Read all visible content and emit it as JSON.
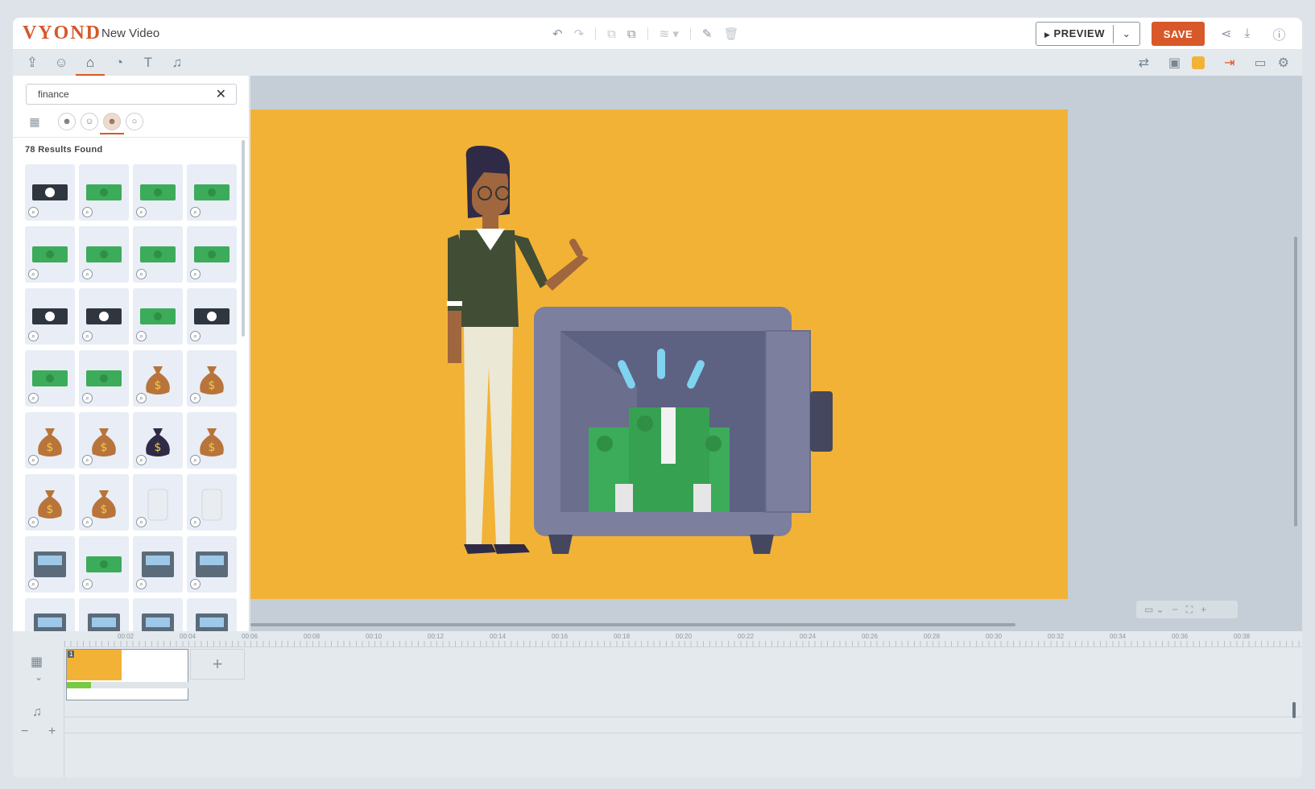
{
  "header": {
    "logo": "VYOND",
    "title": "New Video",
    "preview_label": "PREVIEW",
    "save_label": "SAVE"
  },
  "panel": {
    "search_value": "finance",
    "results_text": "78 Results Found"
  },
  "timeline": {
    "ticks": [
      "00:02",
      "00:04",
      "00:06",
      "00:08",
      "00:10",
      "00:12",
      "00:14",
      "00:16",
      "00:18",
      "00:20",
      "00:22",
      "00:24",
      "00:26",
      "00:28",
      "00:30",
      "00:32",
      "00:34",
      "00:36",
      "00:38"
    ],
    "scene_number": "1"
  },
  "colors": {
    "accent": "#d9582a",
    "canvas_bg": "#f2b236",
    "money_green": "#3cab5a"
  },
  "assets": [
    "bill-outline-icon",
    "bills-fan-icon",
    "money-stacks-icon",
    "bill-green-icon",
    "bill-band-icon",
    "bill-stack-icon",
    "bill-single-icon",
    "bills-fan-icon",
    "bill-dark-icon",
    "bill-dark-stack-icon",
    "bill-flying-icon",
    "bill-dark-pile-icon",
    "bill-wings-icon",
    "bills-flying-icon",
    "money-bag-dollar-icon",
    "money-bag-full-icon",
    "money-bag-icon",
    "money-sack-full-icon",
    "money-bag-dark-dollar-icon",
    "money-bag-pound-icon",
    "money-bag-euro-icon",
    "money-bag-yen-icon",
    "money-jar-icon",
    "empty-jar-icon",
    "atm-icon",
    "bill-green-icon",
    "atm-keypad-icon",
    "atm-dispense-icon",
    "bank-building-icon",
    "bank-columns-icon",
    "card-icon",
    "check-pay-icon"
  ]
}
